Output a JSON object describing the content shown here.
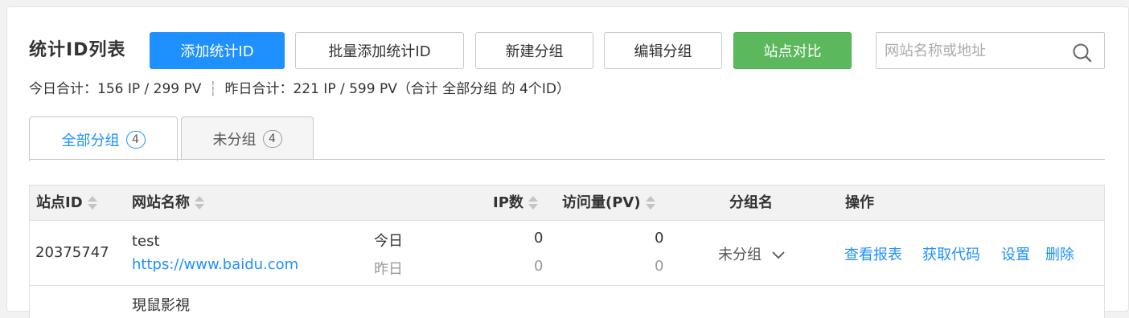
{
  "header": {
    "title": "统计ID列表",
    "buttons": {
      "add": "添加统计ID",
      "batch_add": "批量添加统计ID",
      "new_group": "新建分组",
      "edit_group": "编辑分组",
      "compare": "站点对比"
    },
    "search_placeholder": "网站名称或地址"
  },
  "summary": {
    "today": "今日合计：156 IP / 299 PV",
    "separator": "┆",
    "yesterday": "昨日合计：221 IP / 599 PV（合计 全部分组 的 4个ID）"
  },
  "tabs": [
    {
      "label": "全部分组",
      "count": "4"
    },
    {
      "label": "未分组",
      "count": "4"
    }
  ],
  "table": {
    "columns": {
      "site_id": "站点ID",
      "site_name": "网站名称",
      "ip": "IP数",
      "pv": "访问量(PV)",
      "group": "分组名",
      "actions": "操作"
    },
    "rows": [
      {
        "id": "20375747",
        "name": "test",
        "url": "https://www.baidu.com",
        "today_label": "今日",
        "yesterday_label": "昨日",
        "today_ip": "0",
        "today_pv": "0",
        "yesterday_ip": "0",
        "yesterday_pv": "0",
        "group": "未分组",
        "actions": [
          "查看报表",
          "获取代码",
          "设置",
          "删除"
        ]
      }
    ],
    "partial_row_name": "現鼠影視"
  }
}
